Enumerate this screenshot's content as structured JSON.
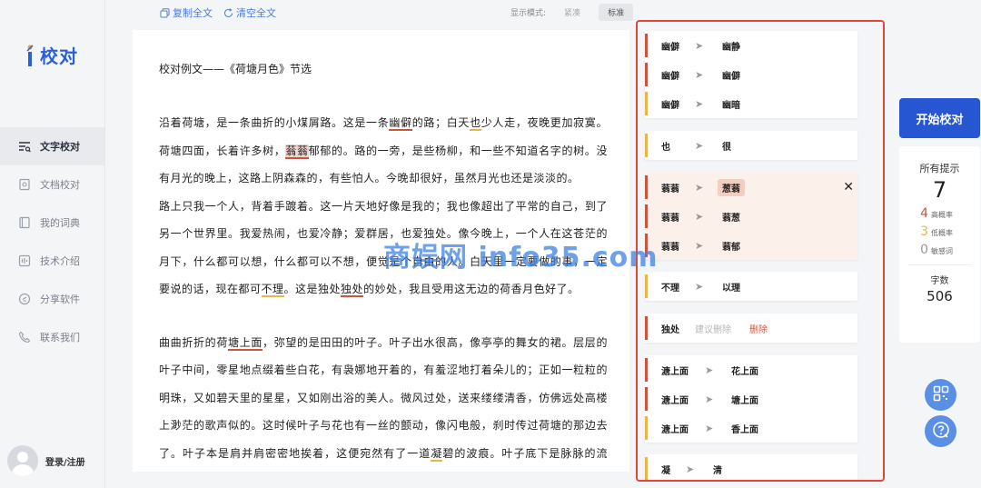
{
  "app": {
    "logo_text": "校对"
  },
  "nav": [
    {
      "label": "文字校对",
      "icon": "text-check-icon",
      "active": true
    },
    {
      "label": "文档校对",
      "icon": "document-icon",
      "active": false
    },
    {
      "label": "我的词典",
      "icon": "dictionary-icon",
      "active": false
    },
    {
      "label": "技术介绍",
      "icon": "tech-icon",
      "active": false
    },
    {
      "label": "分享软件",
      "icon": "share-icon",
      "active": false
    },
    {
      "label": "联系我们",
      "icon": "phone-icon",
      "active": false
    }
  ],
  "user": {
    "login_label": "登录/注册"
  },
  "toolbar": {
    "copy_label": "复制全文",
    "clear_label": "清空全文"
  },
  "mode": {
    "label": "显示模式:",
    "compact": "紧凑",
    "standard": "标准",
    "selected": "标准"
  },
  "document": {
    "title": "校对例文——《荷塘月色》节选",
    "p1": [
      "沿着荷塘，是一条曲折的小煤屑路。这是一条",
      "幽僻",
      "的路；白天",
      "也",
      "少人走，夜晚更加寂寞。荷塘四面，长着许多树，",
      "蓊蓊",
      "郁郁的。路的一旁，是些杨柳，和一些不知道名字的树。没有月光的晚上，这路上阴森森的，有些怕人。今晚却很好，虽然月光也还是淡淡的。"
    ],
    "p2": [
      "路上只我一个人，背着手踱着。这一片天地好像是我的；我也像超出了平常的自己，到了另一个世界里。我爱热闹，也爱冷静；爱群居，也爱独处。像今晚上，一个人在这苍茫的月下，什么都可以想，什么都可以不想，便觉是个自由的人。白天里一定要做的事，一定要说的话，现在都可",
      "不理",
      "。这是独处",
      "独处",
      "的妙处，我且受用这无边的荷香月色好了。"
    ],
    "p3": [
      "曲曲折折的荷",
      "塘上面",
      "，弥望的是田田的叶子。叶子出水很高，像亭亭的舞女的裙。层层的叶子中间，零星地点缀着些白花，有袅娜地开着的，有羞涩地打着朵儿的；正如一粒粒的明珠，又如碧天里的星星，又如刚出浴的美人。微风过处，送来缕缕清香，仿佛远处高楼上渺茫的歌声似的。这时候叶子与花也有一丝的颤动，像闪电般，刹时传过荷塘的那边去了。叶子本是肩并肩密密地挨着，这便宛然有了一道",
      "凝",
      "碧的波痕。叶子底下是脉脉的流水，遮住了，不能见一些"
    ]
  },
  "suggestions": {
    "g1": [
      {
        "src": "幽僻",
        "dst": "幽静",
        "level": "high"
      },
      {
        "src": "幽僻",
        "dst": "幽僻",
        "level": "high"
      },
      {
        "src": "幽僻",
        "dst": "幽暗",
        "level": "low"
      }
    ],
    "g2": [
      {
        "src": "也",
        "dst": "很",
        "level": "low"
      }
    ],
    "g3": [
      {
        "src": "蓊蓊",
        "dst": "葱蓊",
        "level": "high"
      },
      {
        "src": "蓊蓊",
        "dst": "蓊葱",
        "level": "high"
      },
      {
        "src": "蓊蓊",
        "dst": "蓊郁",
        "level": "high"
      }
    ],
    "g4": [
      {
        "src": "不理",
        "dst": "以理",
        "level": "low"
      }
    ],
    "g5": {
      "src": "独处",
      "hint": "建议删除",
      "action": "删除",
      "level": "high"
    },
    "g6": [
      {
        "src": "溏上面",
        "dst": "花上面",
        "level": "high"
      },
      {
        "src": "溏上面",
        "dst": "塘上面",
        "level": "high"
      },
      {
        "src": "溏上面",
        "dst": "香上面",
        "level": "low"
      }
    ],
    "g7": [
      {
        "src": "凝",
        "dst": "清",
        "level": "low"
      }
    ]
  },
  "actions": {
    "start_label": "开始校对"
  },
  "stats": {
    "all_label": "所有提示",
    "all_count": "7",
    "high_count": "4",
    "high_label": "高概率",
    "low_count": "3",
    "low_label": "低概率",
    "sensitive_count": "0",
    "sensitive_label": "敏感词",
    "word_label": "字数",
    "word_count": "506"
  },
  "colors": {
    "accent": "#2756d2",
    "high": "#c8553d",
    "low": "#e6b84a",
    "panel_border": "#e0463a"
  },
  "watermark": "商娱网 info35.com"
}
